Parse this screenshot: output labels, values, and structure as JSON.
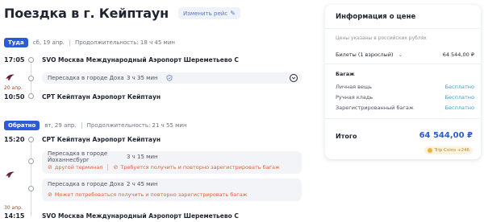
{
  "header": {
    "title": "Поездка в г. Кейптаун",
    "change_label": "Изменить рейс"
  },
  "outbound": {
    "badge": "Туда",
    "date": "сб, 19 апр.",
    "duration": "Продолжительность: 18 ч 45 мин",
    "dep_time": "17:05",
    "dep_airport": "SVO Москва Международный Аэропорт Шереметьево С",
    "transfer_city": "Пересадка в городе Доха",
    "transfer_duration": "3 ч 35 мин",
    "arr_day_note": "20 апр.",
    "arr_time": "10:50",
    "arr_airport": "CPT Кейптаун Аэропорт Кейптаун"
  },
  "return": {
    "badge": "Обратно",
    "date": "вт, 29 апр.",
    "duration": "Продолжительность: 21 ч 55 мин",
    "dep_time": "15:20",
    "dep_airport": "CPT Кейптаун Аэропорт Кейптаун",
    "transfer1_city": "Пересадка в городе Йоханнесбург",
    "transfer1_duration": "3 ч 15 мин",
    "transfer1_warn_a": "другой терминал",
    "transfer1_warn_b": "Требуется получить и повторно зарегистрировать багаж",
    "transfer2_city": "Пересадка в городе Доха",
    "transfer2_duration": "2 ч 45 мин",
    "transfer2_warn": "Может потребоваться получить и повторно зарегистрировать багаж",
    "arr_day_note": "30 апр.",
    "arr_time": "14:15",
    "arr_airport": "SVO Москва Международный Аэропорт Шереметьево С"
  },
  "price_card": {
    "title": "Информация о цене",
    "note": "Цены указаны в российских рублях",
    "tickets_label": "Билеты (1 взрослый)",
    "tickets_value": "64 544,00 ₽",
    "baggage_title": "Багаж",
    "baggage_items": [
      {
        "label": "Личная вещь",
        "value": "Бесплатно"
      },
      {
        "label": "Ручная кладь",
        "value": "Бесплатно"
      },
      {
        "label": "Зарегистрированный багаж",
        "value": "Бесплатно"
      }
    ],
    "total_label": "Итого",
    "total_value": "64 544,00 ₽",
    "coins_label": "Trip Coins +246"
  },
  "colors": {
    "accent": "#2d5bd7",
    "free": "#3aa0c4",
    "warning": "#e2623a"
  }
}
